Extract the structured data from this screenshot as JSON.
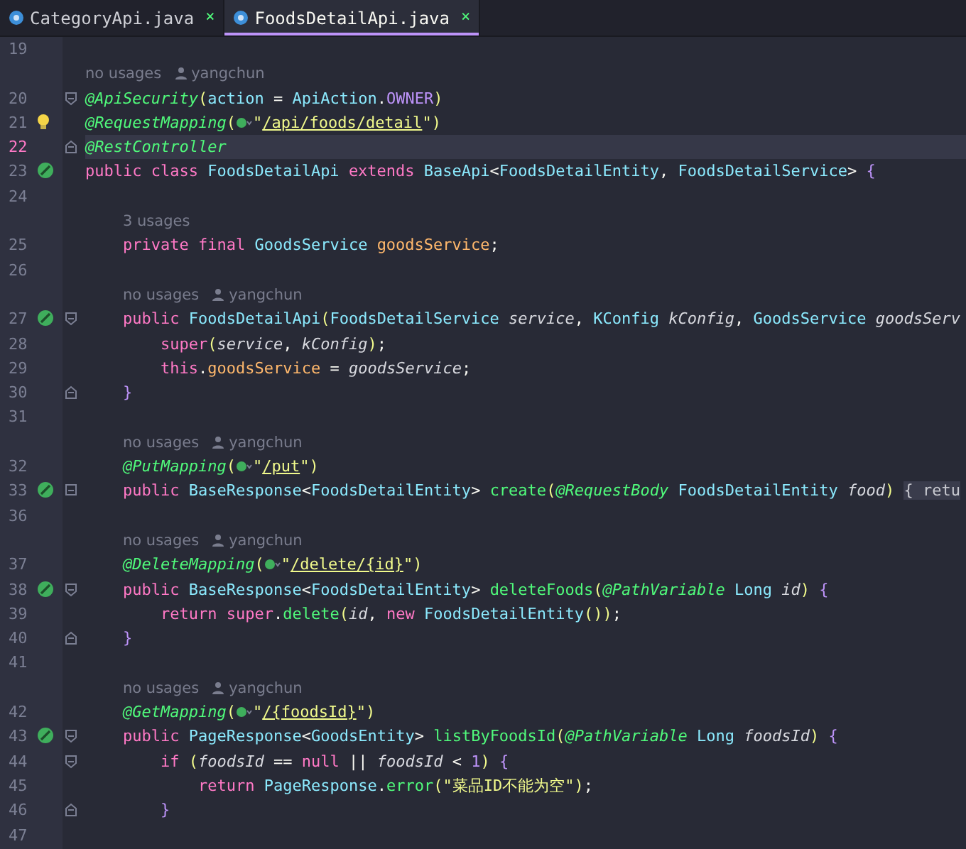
{
  "tabs": [
    {
      "label": "CategoryApi.java",
      "close": "×",
      "selected": false
    },
    {
      "label": "FoodsDetailApi.java",
      "close": "×",
      "selected": true
    }
  ],
  "rows": [
    {
      "number": "19"
    },
    {
      "usages": "no usages",
      "author": "yangchun"
    },
    {
      "number": "20",
      "fold_start": true,
      "segs": [
        {
          "kind": "ann",
          "text": "@ApiSecurity"
        },
        {
          "kind": "paren",
          "text": "("
        },
        {
          "kind": "attr",
          "text": "action"
        },
        {
          "kind": "plain",
          "text": " = "
        },
        {
          "kind": "type",
          "text": "ApiAction"
        },
        {
          "kind": "plain",
          "text": "."
        },
        {
          "kind": "const",
          "text": "OWNER"
        },
        {
          "kind": "paren",
          "text": ")"
        }
      ]
    },
    {
      "number": "21",
      "bulb": true,
      "segs": [
        {
          "kind": "ann",
          "text": "@RequestMapping"
        },
        {
          "kind": "paren",
          "text": "("
        },
        {
          "kind": "globe"
        },
        {
          "kind": "str",
          "text": "\""
        },
        {
          "kind": "link",
          "text": "/api/foods/detail"
        },
        {
          "kind": "str",
          "text": "\""
        },
        {
          "kind": "paren",
          "text": ")"
        }
      ]
    },
    {
      "number": "22",
      "current": true,
      "fold_end": true,
      "segs": [
        {
          "kind": "ann",
          "text": "@RestController"
        }
      ]
    },
    {
      "number": "23",
      "run_icon": true,
      "segs": [
        {
          "kind": "kw",
          "text": "public class "
        },
        {
          "kind": "type",
          "text": "FoodsDetailApi "
        },
        {
          "kind": "kw",
          "text": "extends "
        },
        {
          "kind": "type",
          "text": "BaseApi"
        },
        {
          "kind": "plain",
          "text": "<"
        },
        {
          "kind": "type",
          "text": "FoodsDetailEntity"
        },
        {
          "kind": "plain",
          "text": ", "
        },
        {
          "kind": "type",
          "text": "FoodsDetailService"
        },
        {
          "kind": "plain",
          "text": "> "
        },
        {
          "kind": "brace",
          "text": "{"
        }
      ]
    },
    {
      "number": "24"
    },
    {
      "usages": "3 usages"
    },
    {
      "number": "25",
      "segs": [
        {
          "kind": "kw",
          "text": "    private final "
        },
        {
          "kind": "type",
          "text": "GoodsService "
        },
        {
          "kind": "field",
          "text": "goodsService"
        },
        {
          "kind": "plain",
          "text": ";"
        }
      ]
    },
    {
      "number": "26"
    },
    {
      "usages": "no usages",
      "author": "yangchun"
    },
    {
      "number": "27",
      "run_icon": true,
      "fold_start": true,
      "segs": [
        {
          "kind": "kw",
          "text": "    public "
        },
        {
          "kind": "type",
          "text": "FoodsDetailApi"
        },
        {
          "kind": "paren",
          "text": "("
        },
        {
          "kind": "type",
          "text": "FoodsDetailService "
        },
        {
          "kind": "param",
          "text": "service"
        },
        {
          "kind": "plain",
          "text": ", "
        },
        {
          "kind": "type",
          "text": "KConfig "
        },
        {
          "kind": "param",
          "text": "kConfig"
        },
        {
          "kind": "plain",
          "text": ", "
        },
        {
          "kind": "type",
          "text": "GoodsService "
        },
        {
          "kind": "param",
          "text": "goodsServ"
        }
      ]
    },
    {
      "number": "28",
      "segs": [
        {
          "kind": "kw",
          "text": "        super"
        },
        {
          "kind": "paren",
          "text": "("
        },
        {
          "kind": "param",
          "text": "service"
        },
        {
          "kind": "plain",
          "text": ", "
        },
        {
          "kind": "param",
          "text": "kConfig"
        },
        {
          "kind": "paren",
          "text": ")"
        },
        {
          "kind": "plain",
          "text": ";"
        }
      ]
    },
    {
      "number": "29",
      "segs": [
        {
          "kind": "kw",
          "text": "        this"
        },
        {
          "kind": "plain",
          "text": "."
        },
        {
          "kind": "field",
          "text": "goodsService"
        },
        {
          "kind": "plain",
          "text": " = "
        },
        {
          "kind": "param",
          "text": "goodsService"
        },
        {
          "kind": "plain",
          "text": ";"
        }
      ]
    },
    {
      "number": "30",
      "fold_end": true,
      "segs": [
        {
          "kind": "brace",
          "text": "    }"
        }
      ]
    },
    {
      "number": "31"
    },
    {
      "usages": "no usages",
      "author": "yangchun"
    },
    {
      "number": "32",
      "segs": [
        {
          "kind": "ann",
          "text": "    @PutMapping"
        },
        {
          "kind": "paren",
          "text": "("
        },
        {
          "kind": "globe"
        },
        {
          "kind": "str",
          "text": "\""
        },
        {
          "kind": "link",
          "text": "/put"
        },
        {
          "kind": "str",
          "text": "\""
        },
        {
          "kind": "paren",
          "text": ")"
        }
      ]
    },
    {
      "number": "33",
      "run_icon": true,
      "fold_collapsed": true,
      "segs": [
        {
          "kind": "kw",
          "text": "    public "
        },
        {
          "kind": "type",
          "text": "BaseResponse"
        },
        {
          "kind": "plain",
          "text": "<"
        },
        {
          "kind": "type",
          "text": "FoodsDetailEntity"
        },
        {
          "kind": "plain",
          "text": "> "
        },
        {
          "kind": "fn",
          "text": "create"
        },
        {
          "kind": "paren",
          "text": "("
        },
        {
          "kind": "ann",
          "text": "@RequestBody "
        },
        {
          "kind": "type",
          "text": "FoodsDetailEntity "
        },
        {
          "kind": "param",
          "text": "food"
        },
        {
          "kind": "paren",
          "text": ") "
        },
        {
          "kind": "folded",
          "text": "{ retu"
        }
      ]
    },
    {
      "number": "36"
    },
    {
      "usages": "no usages",
      "author": "yangchun"
    },
    {
      "number": "37",
      "segs": [
        {
          "kind": "ann",
          "text": "    @DeleteMapping"
        },
        {
          "kind": "paren",
          "text": "("
        },
        {
          "kind": "globe"
        },
        {
          "kind": "str",
          "text": "\""
        },
        {
          "kind": "link",
          "text": "/delete/{id}"
        },
        {
          "kind": "str",
          "text": "\""
        },
        {
          "kind": "paren",
          "text": ")"
        }
      ]
    },
    {
      "number": "38",
      "run_icon": true,
      "fold_start": true,
      "segs": [
        {
          "kind": "kw",
          "text": "    public "
        },
        {
          "kind": "type",
          "text": "BaseResponse"
        },
        {
          "kind": "plain",
          "text": "<"
        },
        {
          "kind": "type",
          "text": "FoodsDetailEntity"
        },
        {
          "kind": "plain",
          "text": "> "
        },
        {
          "kind": "fn",
          "text": "deleteFoods"
        },
        {
          "kind": "paren",
          "text": "("
        },
        {
          "kind": "ann",
          "text": "@PathVariable "
        },
        {
          "kind": "type",
          "text": "Long "
        },
        {
          "kind": "param",
          "text": "id"
        },
        {
          "kind": "paren",
          "text": ")"
        },
        {
          "kind": "brace",
          "text": " {"
        }
      ]
    },
    {
      "number": "39",
      "segs": [
        {
          "kind": "kw",
          "text": "        return super"
        },
        {
          "kind": "plain",
          "text": "."
        },
        {
          "kind": "fn",
          "text": "delete"
        },
        {
          "kind": "paren",
          "text": "("
        },
        {
          "kind": "param",
          "text": "id"
        },
        {
          "kind": "plain",
          "text": ", "
        },
        {
          "kind": "kw",
          "text": "new "
        },
        {
          "kind": "type",
          "text": "FoodsDetailEntity"
        },
        {
          "kind": "paren",
          "text": "())"
        },
        {
          "kind": "plain",
          "text": ";"
        }
      ]
    },
    {
      "number": "40",
      "fold_end": true,
      "segs": [
        {
          "kind": "brace",
          "text": "    }"
        }
      ]
    },
    {
      "number": "41"
    },
    {
      "usages": "no usages",
      "author": "yangchun"
    },
    {
      "number": "42",
      "segs": [
        {
          "kind": "ann",
          "text": "    @GetMapping"
        },
        {
          "kind": "paren",
          "text": "("
        },
        {
          "kind": "globe"
        },
        {
          "kind": "str",
          "text": "\""
        },
        {
          "kind": "link",
          "text": "/{foodsId}"
        },
        {
          "kind": "str",
          "text": "\""
        },
        {
          "kind": "paren",
          "text": ")"
        }
      ]
    },
    {
      "number": "43",
      "run_icon": true,
      "fold_start": true,
      "segs": [
        {
          "kind": "kw",
          "text": "    public "
        },
        {
          "kind": "type",
          "text": "PageResponse"
        },
        {
          "kind": "plain",
          "text": "<"
        },
        {
          "kind": "type",
          "text": "GoodsEntity"
        },
        {
          "kind": "plain",
          "text": "> "
        },
        {
          "kind": "fn",
          "text": "listByFoodsId"
        },
        {
          "kind": "paren",
          "text": "("
        },
        {
          "kind": "ann",
          "text": "@PathVariable "
        },
        {
          "kind": "type",
          "text": "Long "
        },
        {
          "kind": "param",
          "text": "foodsId"
        },
        {
          "kind": "paren",
          "text": ")"
        },
        {
          "kind": "brace",
          "text": " {"
        }
      ]
    },
    {
      "number": "44",
      "fold_start": true,
      "segs": [
        {
          "kind": "kw",
          "text": "        if "
        },
        {
          "kind": "paren",
          "text": "("
        },
        {
          "kind": "param",
          "text": "foodsId"
        },
        {
          "kind": "plain",
          "text": " == "
        },
        {
          "kind": "kw",
          "text": "null "
        },
        {
          "kind": "plain",
          "text": "|| "
        },
        {
          "kind": "param",
          "text": "foodsId"
        },
        {
          "kind": "plain",
          "text": " < "
        },
        {
          "kind": "const",
          "text": "1"
        },
        {
          "kind": "paren",
          "text": ")"
        },
        {
          "kind": "brace",
          "text": " {"
        }
      ]
    },
    {
      "number": "45",
      "segs": [
        {
          "kind": "kw",
          "text": "            return "
        },
        {
          "kind": "type",
          "text": "PageResponse"
        },
        {
          "kind": "plain",
          "text": "."
        },
        {
          "kind": "fn",
          "text": "error"
        },
        {
          "kind": "paren",
          "text": "("
        },
        {
          "kind": "str",
          "text": "\"菜品ID不能为空\""
        },
        {
          "kind": "paren",
          "text": ")"
        },
        {
          "kind": "plain",
          "text": ";"
        }
      ]
    },
    {
      "number": "46",
      "fold_end": true,
      "segs": [
        {
          "kind": "brace",
          "text": "        }"
        }
      ]
    },
    {
      "number": "47"
    }
  ]
}
